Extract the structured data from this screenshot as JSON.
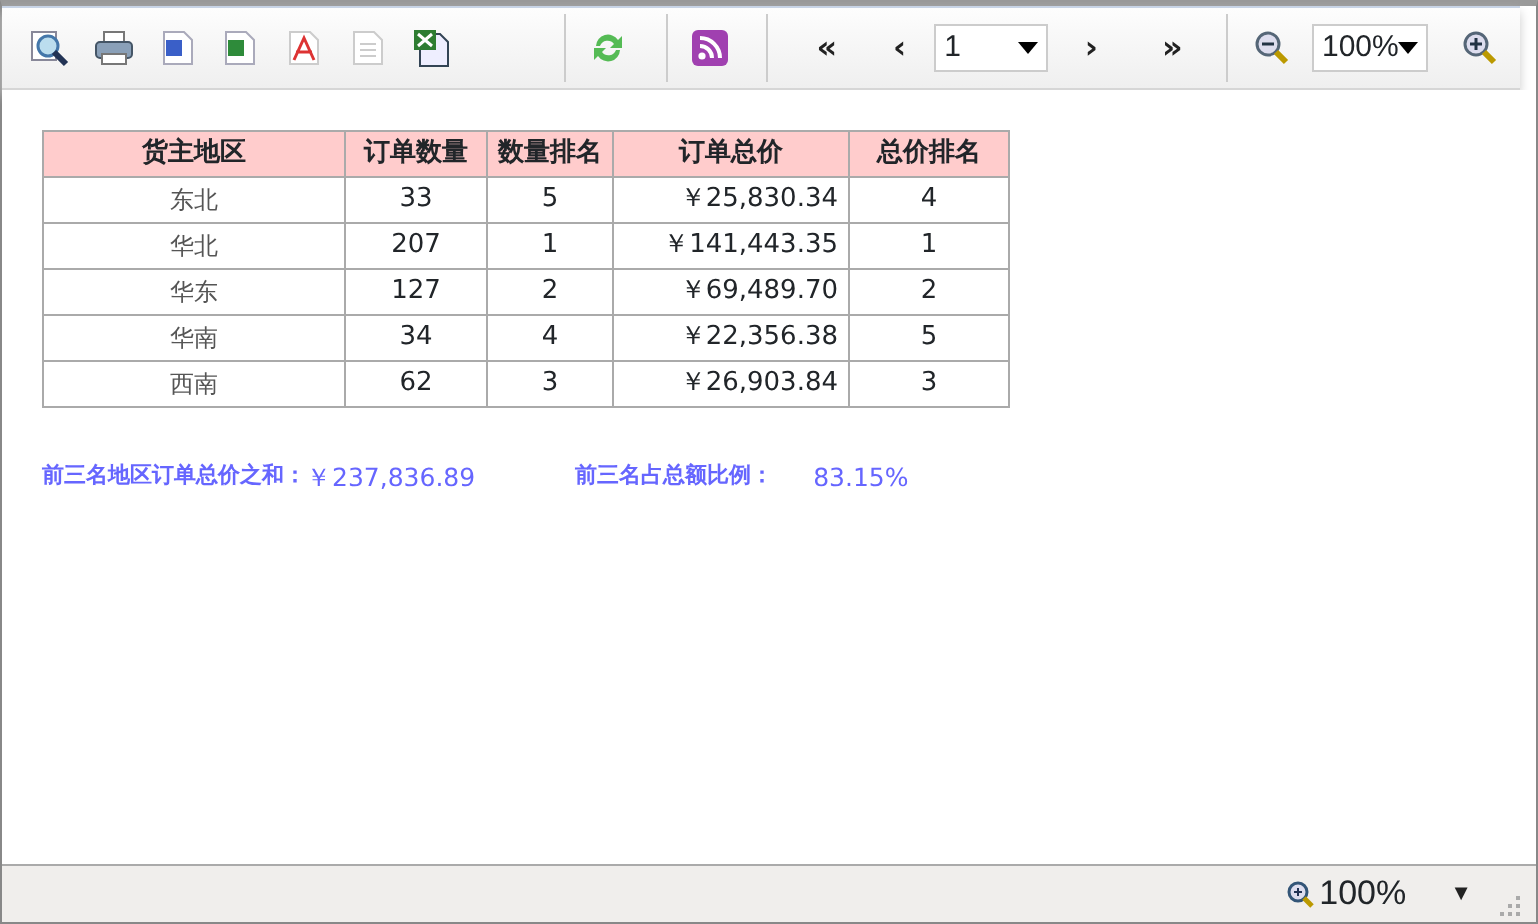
{
  "toolbar": {
    "nav": {
      "first": "«",
      "prev": "‹",
      "next": "›",
      "last": "»"
    },
    "page": "1",
    "zoom": "100%"
  },
  "table": {
    "columns": [
      "货主地区",
      "订单数量",
      "数量排名",
      "订单总价",
      "总价排名"
    ],
    "rows": [
      [
        "东北",
        "33",
        "5",
        "￥25,830.34",
        "4"
      ],
      [
        "华北",
        "207",
        "1",
        "￥141,443.35",
        "1"
      ],
      [
        "华东",
        "127",
        "2",
        "￥69,489.70",
        "2"
      ],
      [
        "华南",
        "34",
        "4",
        "￥22,356.38",
        "5"
      ],
      [
        "西南",
        "62",
        "3",
        "￥26,903.84",
        "3"
      ]
    ]
  },
  "summary": [
    {
      "label": "前三名地区订单总价之和：",
      "value": "￥237,836.89"
    },
    {
      "label": "前三名占总额比例：",
      "value": "83.15%"
    }
  ],
  "status_bar": {
    "zoom": "100%",
    "caret": "▼"
  }
}
